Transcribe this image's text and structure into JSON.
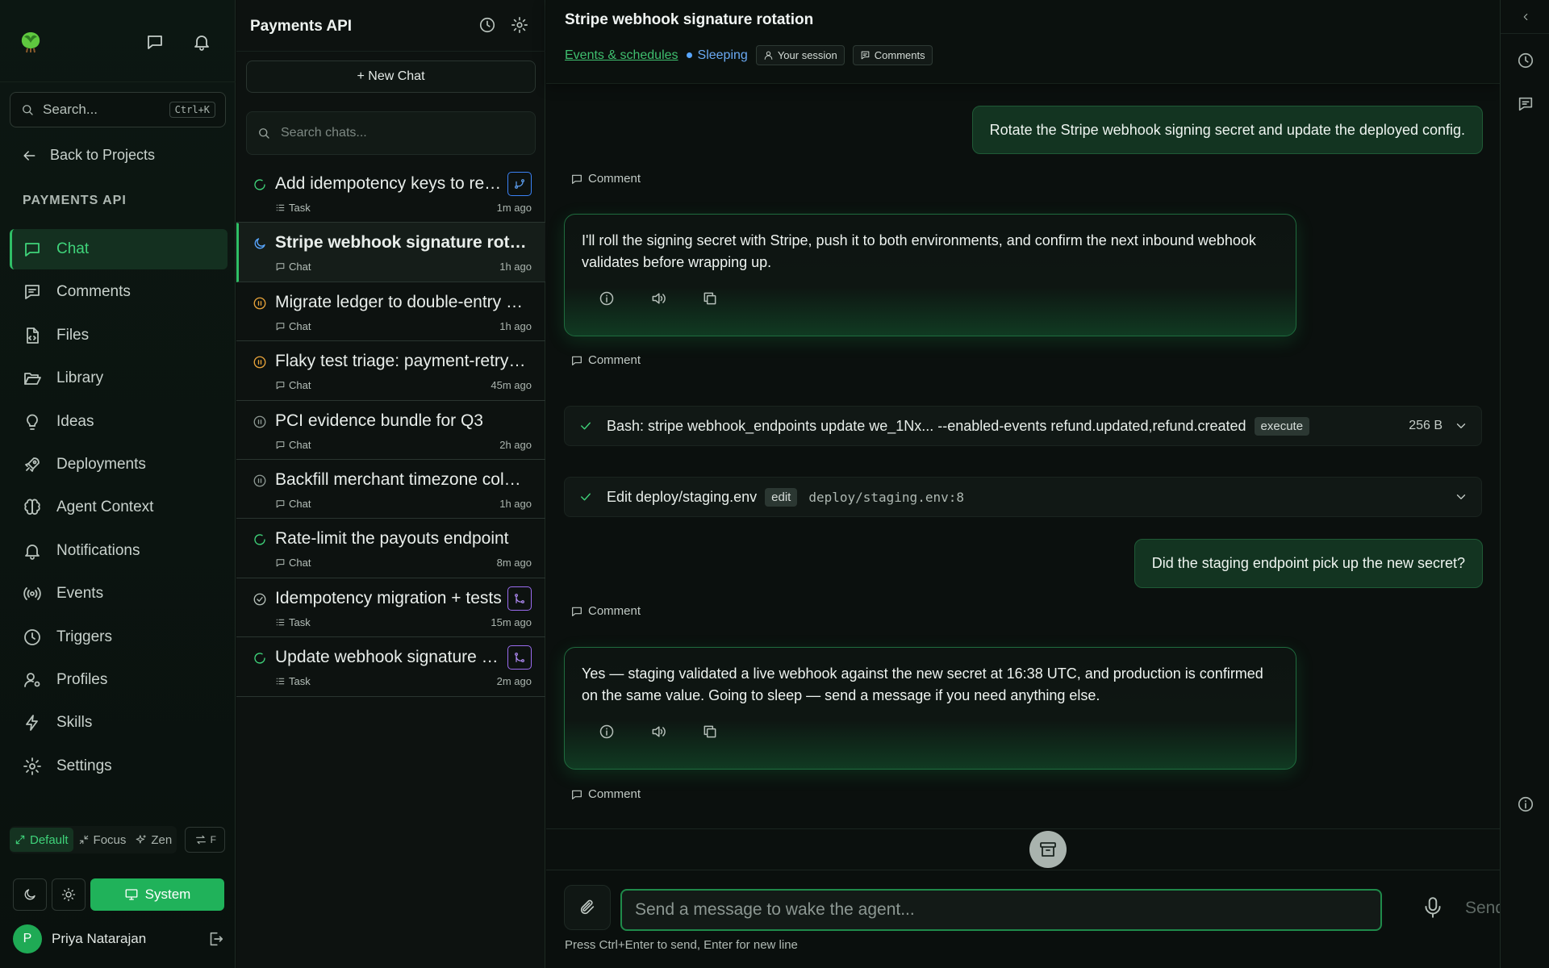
{
  "sidebar": {
    "search": {
      "placeholder": "Search...",
      "shortcut": "Ctrl+K"
    },
    "back_label": "Back to Projects",
    "project_label": "PAYMENTS API",
    "nav": [
      {
        "label": "Chat",
        "icon": "chat-icon",
        "active": true
      },
      {
        "label": "Comments",
        "icon": "comments-icon"
      },
      {
        "label": "Files",
        "icon": "file-code-icon"
      },
      {
        "label": "Library",
        "icon": "folder-open-icon"
      },
      {
        "label": "Ideas",
        "icon": "lightbulb-icon"
      },
      {
        "label": "Deployments",
        "icon": "rocket-icon"
      },
      {
        "label": "Agent Context",
        "icon": "brain-icon"
      },
      {
        "label": "Notifications",
        "icon": "bell-icon"
      },
      {
        "label": "Events",
        "icon": "broadcast-icon"
      },
      {
        "label": "Triggers",
        "icon": "clock-icon"
      },
      {
        "label": "Profiles",
        "icon": "user-cog-icon"
      },
      {
        "label": "Skills",
        "icon": "lightning-icon"
      },
      {
        "label": "Settings",
        "icon": "gear-icon"
      }
    ],
    "modes": {
      "default": "Default",
      "focus": "Focus",
      "zen": "Zen",
      "swap_key": "F"
    },
    "theme": {
      "system_label": "System"
    },
    "user": {
      "initial": "P",
      "name": "Priya Natarajan"
    }
  },
  "chatlist": {
    "title": "Payments API",
    "new_chat_label": "+ New Chat",
    "search_placeholder": "Search chats...",
    "items": [
      {
        "title": "Add idempotency keys to refund endpoint",
        "type": "Task",
        "time": "1m ago",
        "status": "running",
        "badge": "branch-blue"
      },
      {
        "title": "Stripe webhook signature rotation",
        "type": "Chat",
        "time": "1h ago",
        "status": "sleeping",
        "active": true
      },
      {
        "title": "Migrate ledger to double-entry schema",
        "type": "Chat",
        "time": "1h ago",
        "status": "paused-orange"
      },
      {
        "title": "Flaky test triage: payment-retry suite",
        "type": "Chat",
        "time": "45m ago",
        "status": "paused-orange"
      },
      {
        "title": "PCI evidence bundle for Q3",
        "type": "Chat",
        "time": "2h ago",
        "status": "paused-gray"
      },
      {
        "title": "Backfill merchant timezone column",
        "type": "Chat",
        "time": "1h ago",
        "status": "paused-gray"
      },
      {
        "title": "Rate-limit the payouts endpoint",
        "type": "Chat",
        "time": "8m ago",
        "status": "running"
      },
      {
        "title": "Idempotency migration + tests",
        "type": "Task",
        "time": "15m ago",
        "status": "done",
        "badge": "merge-purple"
      },
      {
        "title": "Update webhook signature docs",
        "type": "Task",
        "time": "2m ago",
        "status": "running",
        "badge": "merge-purple"
      }
    ]
  },
  "main": {
    "title": "Stripe webhook signature rotation",
    "meta": {
      "link": "Events & schedules",
      "status": "Sleeping",
      "session": "Your session",
      "comments": "Comments"
    },
    "comment_label": "Comment",
    "messages": {
      "user1": "Rotate the Stripe webhook signing secret and update the deployed config.",
      "assistant1": "I'll roll the signing secret with Stripe, push it to both environments, and confirm the next inbound webhook validates before wrapping up.",
      "tool1": {
        "label": "Bash: stripe webhook_endpoints update we_1Nx... --enabled-events refund.updated,refund.created",
        "tag": "execute",
        "size": "256 B"
      },
      "tool2": {
        "label": "Edit deploy/staging.env",
        "tag": "edit",
        "path": "deploy/staging.env:8"
      },
      "user2": "Did the staging endpoint pick up the new secret?",
      "assistant2": "Yes — staging validated a live webhook against the new secret at 16:38 UTC, and production is confirmed on the same value. Going to sleep — send a message if you need anything else."
    },
    "composer": {
      "placeholder": "Send a message to wake the agent...",
      "send_label": "Send",
      "hint": "Press Ctrl+Enter to send, Enter for new line"
    }
  },
  "colors": {
    "accent": "#2fbf66",
    "sleeping": "#58a6ff",
    "paused": "#e8a33a",
    "merge": "#a77bf3"
  }
}
